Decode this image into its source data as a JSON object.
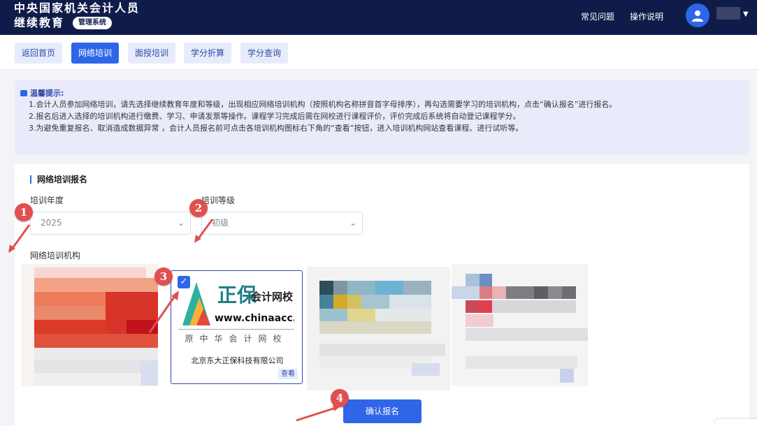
{
  "header": {
    "title_line1": "中央国家机关会计人员",
    "title_line2": "继续教育",
    "badge": "管理系统",
    "faq": "常见问题",
    "guide": "操作说明"
  },
  "tabs": [
    {
      "label": "返回首页"
    },
    {
      "label": "网络培训"
    },
    {
      "label": "面授培训"
    },
    {
      "label": "学分折算"
    },
    {
      "label": "学分查询"
    }
  ],
  "notice": {
    "title": "温馨提示:",
    "lines": [
      "1.会计人员参加网络培训，请先选择继续教育年度和等级，出现相应网络培训机构（按照机构名称拼音首字母排序），再勾选需要学习的培训机构，点击“确认报名”进行报名。",
      "2.报名后进入选择的培训机构进行缴费、学习、申请发票等操作。课程学习完成后需在网校进行课程评价，评价完成后系统将自动登记课程学分。",
      "3.为避免重复报名、取消造成数据异常 ，会计人员报名前可点击各培训机构图标右下角的“查看”按钮，进入培训机构网站查看课程、进行试听等。"
    ]
  },
  "form": {
    "section_title": "网络培训报名",
    "year_label": "培训年度",
    "year_value": "2025",
    "level_label": "培训等级",
    "level_value": "初级",
    "institution_label": "网络培训机构",
    "confirm": "确认报名"
  },
  "institution_zb": {
    "brand": "正保",
    "brand_sub": "会计网校",
    "url": "www.chinaacc.com",
    "motto": "原中华会计网校",
    "company": "北京东大正保科技有限公司",
    "view": "查看"
  },
  "markers": [
    "1",
    "2",
    "3",
    "4"
  ],
  "colors": {
    "header_bg": "#0f1c4a",
    "primary": "#2f66e8",
    "marker": "#e24f4f"
  }
}
